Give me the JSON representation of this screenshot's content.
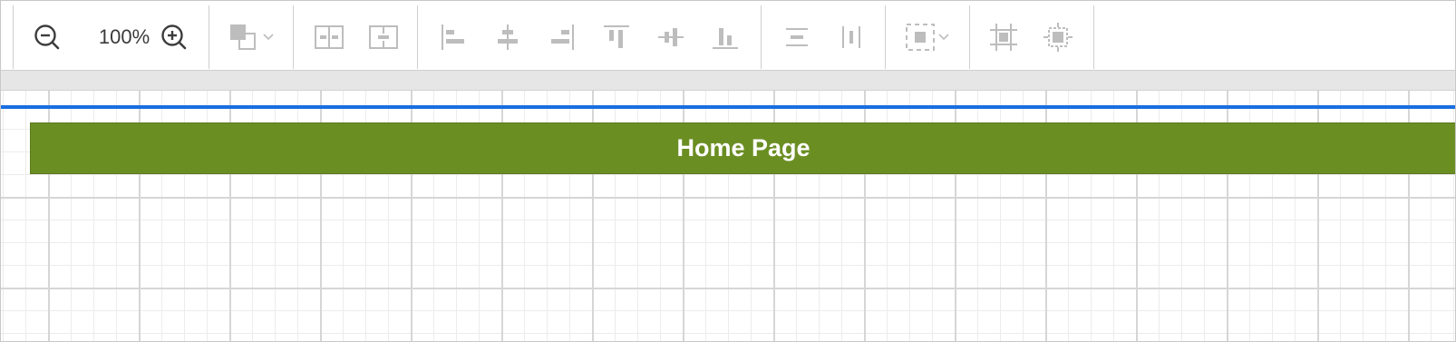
{
  "toolbar": {
    "zoom_value": "100%",
    "icons": {
      "zoom_out": "zoom-out-icon",
      "zoom_in": "zoom-in-icon",
      "order": "bring-to-front-icon",
      "space_horizontal": "distribute-horizontal-icon",
      "space_vertical": "distribute-vertical-icon",
      "align_left": "align-left-icon",
      "align_center": "align-center-icon",
      "align_right": "align-right-icon",
      "align_top": "align-top-icon",
      "align_middle": "align-middle-icon",
      "align_bottom": "align-bottom-icon",
      "same_width": "same-width-icon",
      "same_height": "same-height-icon",
      "select": "select-icon",
      "group": "group-icon",
      "ungroup": "ungroup-icon"
    }
  },
  "diagram": {
    "lane_header": "Home Page"
  },
  "colors": {
    "lane_header_fill": "#6b8e23",
    "guide_line": "#1a6fe0",
    "icon_disabled": "#bdbdbd",
    "icon_active": "#3c3c3c"
  }
}
